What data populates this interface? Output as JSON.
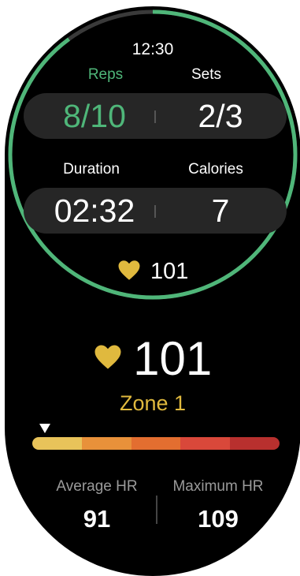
{
  "status": {
    "time": "12:30"
  },
  "workout": {
    "reps_label": "Reps",
    "reps_value": "8/10",
    "sets_label": "Sets",
    "sets_value": "2/3",
    "duration_label": "Duration",
    "duration_value": "02:32",
    "calories_label": "Calories",
    "calories_value": "7"
  },
  "heart_rate": {
    "current": "101",
    "zone": "Zone 1",
    "zone_colors": [
      "#e8c35a",
      "#e8913a",
      "#e36e30",
      "#d9483a",
      "#b8302e"
    ],
    "marker_fraction": 0.05,
    "average_label": "Average HR",
    "average_value": "91",
    "maximum_label": "Maximum HR",
    "maximum_value": "109"
  },
  "colors": {
    "accent_green": "#4fb679",
    "heart": "#e0b93e"
  }
}
